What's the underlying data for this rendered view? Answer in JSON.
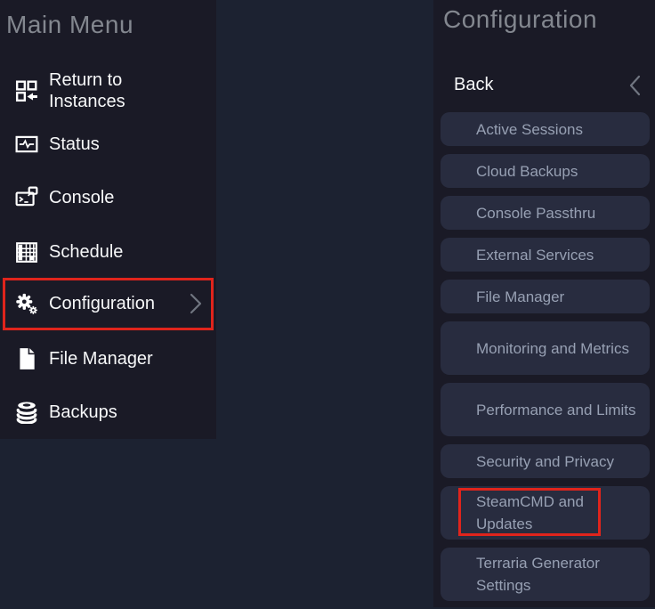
{
  "colors": {
    "page_bg": "#1c2231",
    "panel_bg": "#1a1a26",
    "option_bg": "#282c3f",
    "option_text": "#97a0b3",
    "header_text": "#83878f",
    "item_text": "#f7f8f9",
    "highlight_red": "#e0241c",
    "chevron_gray": "#707580"
  },
  "sidebar": {
    "title": "Main Menu",
    "items": [
      {
        "label": "Return to Instances",
        "icon": "instances-icon"
      },
      {
        "label": "Status",
        "icon": "status-icon"
      },
      {
        "label": "Console",
        "icon": "console-icon"
      },
      {
        "label": "Schedule",
        "icon": "schedule-icon"
      },
      {
        "label": "Configuration",
        "icon": "gears-icon",
        "has_submenu": true,
        "highlighted": true
      },
      {
        "label": "File Manager",
        "icon": "document-icon"
      },
      {
        "label": "Backups",
        "icon": "database-icon"
      }
    ]
  },
  "config_panel": {
    "title": "Configuration",
    "back_label": "Back",
    "items": [
      {
        "label": "Active Sessions"
      },
      {
        "label": "Cloud Backups"
      },
      {
        "label": "Console Passthru"
      },
      {
        "label": "External Services"
      },
      {
        "label": "File Manager"
      },
      {
        "label": "Monitoring and Metrics"
      },
      {
        "label": "Performance and Limits"
      },
      {
        "label": "Security and Privacy"
      },
      {
        "label": "SteamCMD and Updates",
        "highlighted": true
      },
      {
        "label": "Terraria Generator Settings"
      }
    ]
  }
}
